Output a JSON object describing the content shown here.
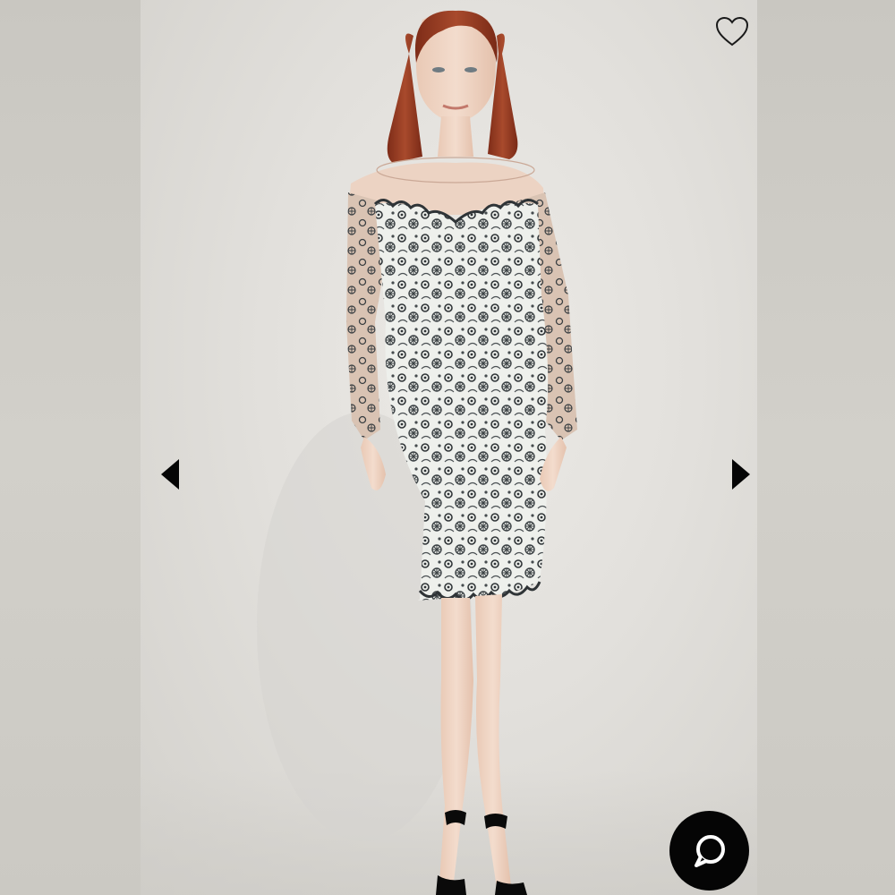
{
  "viewer": {
    "image_alt": "Model wearing a long-sleeve black and white floral lace sheath dress with illusion neckline and black ankle-strap heels",
    "favorite_label": "Add to favorites",
    "prev_label": "Previous image",
    "next_label": "Next image",
    "chat_label": "Open chat"
  },
  "icons": {
    "favorite": "heart-outline-icon",
    "prev": "triangle-left-icon",
    "next": "triangle-right-icon",
    "chat": "speech-bubble-icon"
  },
  "colors": {
    "backdrop": "#e6e4e0",
    "side_panels": "#cdcbc5",
    "arrow": "#050505",
    "chat_button": "#050505",
    "dress_lace": "#3a3f42",
    "hair": "#9a3a22"
  }
}
